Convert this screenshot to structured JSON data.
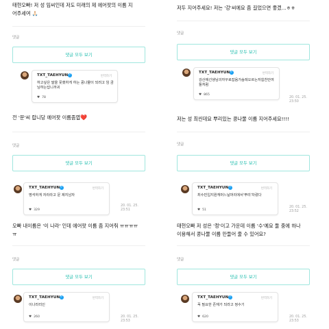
{
  "common": {
    "comment_label": "댓글",
    "view_all": "댓글 모두 보기",
    "username": "TXT_TAEHYUN",
    "translate": "번역하기",
    "verified": "✓",
    "heart": "♥"
  },
  "panels": [
    {
      "question_lines": [
        "태현오빠! 저 성 임씨인데 저도 미래의 제 에어팟의 이름 지",
        "어주세여 🙏🏻"
      ],
      "reply": "하고싶은 말을 못했하게 하는 콩나물이 되려고 임 곰님하는답니까귀",
      "likes": "78",
      "time": ""
    },
    {
      "question_lines": [
        "저두 지어주세요! 저는 '강'씨에요 좀 길었으면 좋겠...ㅎㅎ"
      ],
      "reply": "강산에선생님의까꾸로잡음가슴레오르는저힘찬안여돌처럼",
      "likes": "865",
      "time": "20. 01. 25. 23:50"
    },
    {
      "question_lines": [
        "전 '문'씨 랍니당 에어팟 이름좀엽"
      ],
      "question_heart": "❤️",
      "reply": "명석하게 자라라고 문 제지남자",
      "likes": "329",
      "time": "20. 01. 25. 23:51"
    },
    {
      "question_lines": [
        "저는 성 최씬데요 뿌리있는 콩나물 이름 지어주세요!!!!"
      ],
      "reply": "최수빈입지원캐머느날머리에서'뿌리'차렸다",
      "likes": "51",
      "time": "20. 01. 25. 23:52"
    },
    {
      "question_lines": [
        "오빠 내이름은 '이 나라' 인데 에어팟 이름 좀 지어줘 ㅠㅠㅠㅠ",
        "ㅠ"
      ],
      "reply": "이나라리인",
      "likes": "260",
      "time": "20. 01. 25. 23:53"
    },
    {
      "question_lines": [
        "태현오빠 저 성은 '정'이고 가운데 이름 '수'예요 둘 중에 하나",
        "이용해서 콩나물 이름 만들어 줄 수 있어요?"
      ],
      "reply": "꼭 필요한 존재가 되라고 정수기",
      "likes": "620",
      "time": "20. 01. 25. 23:53"
    }
  ]
}
